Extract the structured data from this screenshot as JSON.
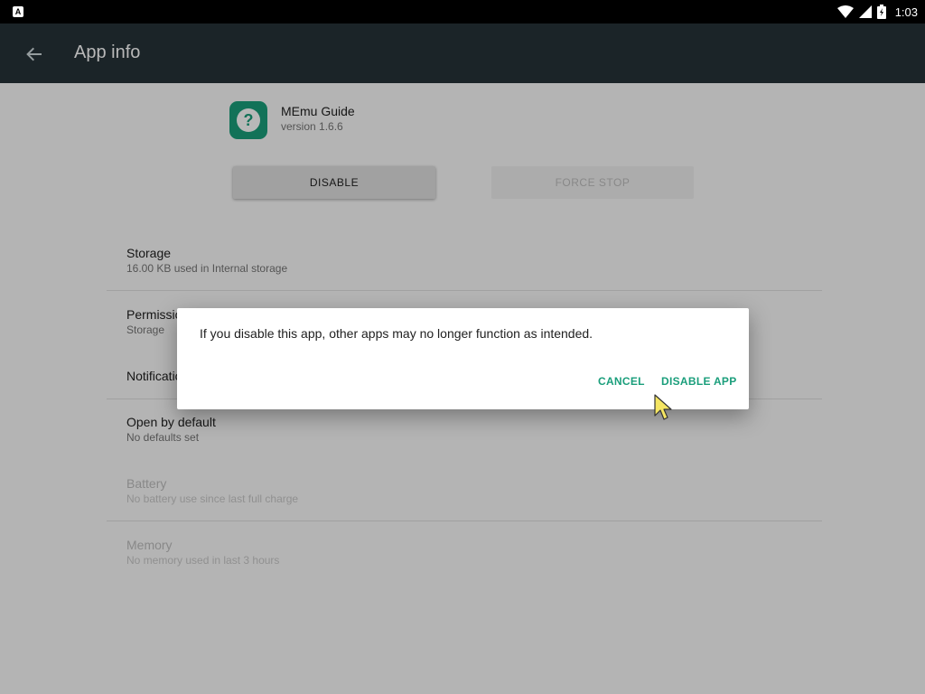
{
  "status_bar": {
    "app_icon_letter": "A",
    "time": "1:03",
    "icons": [
      "wifi-icon",
      "cell-signal-icon",
      "battery-icon"
    ]
  },
  "toolbar": {
    "title": "App info",
    "back_icon": "arrow-back-icon",
    "background": "#263238"
  },
  "app": {
    "name": "MEmu Guide",
    "version": "version 1.6.6",
    "icon": "question-mark-icon",
    "icon_color": "#1a9e7b"
  },
  "actions": {
    "disable_label": "DISABLE",
    "force_stop_label": "FORCE STOP"
  },
  "settings": [
    {
      "title": "Storage",
      "subtitle": "16.00 KB used in Internal storage",
      "enabled": true
    },
    {
      "title": "Permissions",
      "subtitle": "Storage",
      "enabled": true
    },
    {
      "title": "Notifications",
      "subtitle": "",
      "enabled": true
    },
    {
      "title": "Open by default",
      "subtitle": "No defaults set",
      "enabled": true
    },
    {
      "title": "Battery",
      "subtitle": "No battery use since last full charge",
      "enabled": false
    },
    {
      "title": "Memory",
      "subtitle": "No memory used in last 3 hours",
      "enabled": false
    }
  ],
  "dialog": {
    "message": "If you disable this app, other apps may no longer function as intended.",
    "cancel_label": "CANCEL",
    "confirm_label": "DISABLE APP",
    "accent": "#1a9e7b"
  }
}
